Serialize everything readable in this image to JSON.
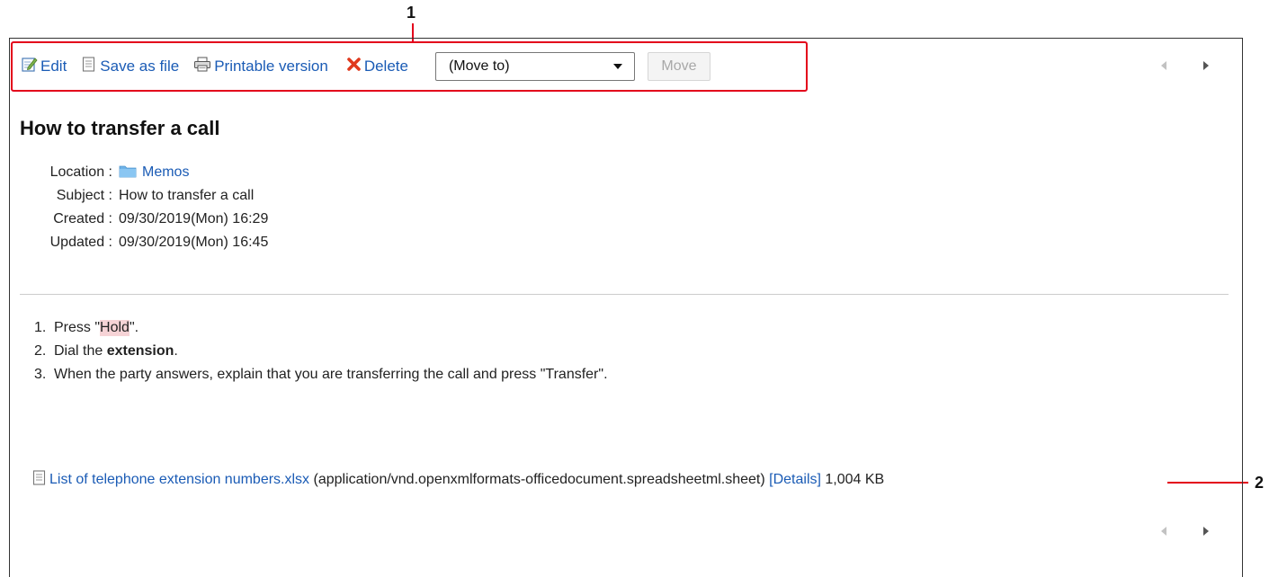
{
  "callouts": {
    "one": "1",
    "two": "2"
  },
  "toolbar": {
    "edit_label": "Edit",
    "save_label": "Save as file",
    "print_label": "Printable version",
    "delete_label": "Delete",
    "move_select_value": "(Move to)",
    "move_button_label": "Move"
  },
  "memo": {
    "title": "How to transfer a call",
    "location_label": "Location :",
    "location_value": "Memos",
    "subject_label": "Subject :",
    "subject_value": "How to transfer a call",
    "created_label": "Created :",
    "created_value": "09/30/2019(Mon) 16:29",
    "updated_label": "Updated :",
    "updated_value": "09/30/2019(Mon) 16:45"
  },
  "steps": {
    "s1_num": "1.",
    "s1_pre": "Press \"",
    "s1_hl": "Hold",
    "s1_post": "\".",
    "s2_num": "2.",
    "s2_pre": "Dial the ",
    "s2_bold": "extension",
    "s2_post": ".",
    "s3_num": "3.",
    "s3_text": "When the party answers, explain that you are transferring the call and press \"Transfer\"."
  },
  "attachment": {
    "filename": "List of telephone extension numbers.xlsx",
    "mime": " (application/vnd.openxmlformats-officedocument.spreadsheetml.sheet) ",
    "details_label": "[Details]",
    "size": " 1,004 KB"
  },
  "colors": {
    "link": "#1a5bb5",
    "callout_red": "#e3001b",
    "delete_red": "#e03a1e",
    "highlight": "#f6d3d6"
  },
  "icons": {
    "edit": "edit-icon",
    "save": "file-icon",
    "print": "printer-icon",
    "delete": "delete-x-icon",
    "folder": "folder-icon",
    "dropdown": "chevron-down-icon",
    "prev": "prev-arrow-icon",
    "next": "next-arrow-icon",
    "attachment": "attachment-file-icon"
  }
}
